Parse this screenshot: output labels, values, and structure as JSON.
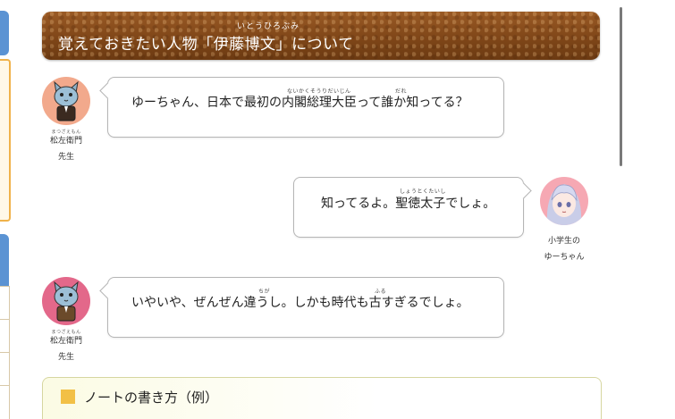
{
  "header": {
    "title": "覚えておきたい人物「伊藤博文」について",
    "ruby": "いとうひろぶみ"
  },
  "dialogue": [
    {
      "speaker": "松左衛門",
      "speaker_ruby": "まつざえもん",
      "speaker_role": "先生",
      "text": "ゆーちゃん、日本で最初の内閣総理大臣って誰か知ってる？",
      "ruby_1": "ないかくそうりだいじん",
      "ruby_2": "だれ"
    },
    {
      "speaker_line1": "小学生の",
      "speaker_line2": "ゆーちゃん",
      "text": "知ってるよ。聖徳太子でしょ。",
      "ruby_1": "しょうとくたいし"
    },
    {
      "speaker": "松左衛門",
      "speaker_ruby": "まつざえもん",
      "speaker_role": "先生",
      "text": "いやいや、ぜんぜん違うし。しかも時代も古すぎるでしょ。",
      "ruby_1": "ちが",
      "ruby_2": "ふる"
    }
  ],
  "note": {
    "title": "ノートの書き方（例）"
  },
  "colors": {
    "banner": "#7f4618",
    "accent_blue": "#5b93d3",
    "accent_yellow": "#f2c046"
  }
}
